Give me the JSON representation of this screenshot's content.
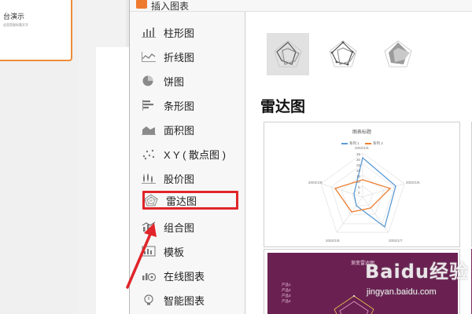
{
  "background_app": {
    "slide_title": "台演示",
    "slide_subtitle": "这里是副标题文字"
  },
  "dialog": {
    "title": "插入图表",
    "sidebar": {
      "items": [
        {
          "label": "柱形图",
          "icon": "column-chart-icon"
        },
        {
          "label": "折线图",
          "icon": "line-chart-icon"
        },
        {
          "label": "饼图",
          "icon": "pie-chart-icon"
        },
        {
          "label": "条形图",
          "icon": "bar-chart-icon"
        },
        {
          "label": "面积图",
          "icon": "area-chart-icon"
        },
        {
          "label": "X Y ( 散点图 )",
          "icon": "scatter-chart-icon"
        },
        {
          "label": "股价图",
          "icon": "stock-chart-icon"
        },
        {
          "label": "雷达图",
          "icon": "radar-chart-icon"
        },
        {
          "label": "组合图",
          "icon": "combo-chart-icon"
        },
        {
          "label": "模板",
          "icon": "template-icon"
        },
        {
          "label": "在线图表",
          "icon": "online-chart-icon"
        },
        {
          "label": "智能图表",
          "icon": "smart-chart-icon"
        }
      ],
      "selected": "雷达图"
    },
    "main": {
      "section_title": "雷达图",
      "subtypes": [
        "radar",
        "radar-with-markers",
        "filled-radar"
      ],
      "preview1": {
        "title": "图表标题",
        "legend": [
          "系列 1",
          "系列 2"
        ],
        "axis_labels": [
          "2002/1/5",
          "2002/1/6",
          "2002/1/7",
          "2002/1/8",
          "2002/1/9"
        ],
        "tick_labels": [
          "35",
          "30",
          "25",
          "20",
          "15",
          "10",
          "5",
          "0"
        ]
      },
      "preview2": {
        "title": "渐变雷达图",
        "legend": [
          "产品1",
          "产品2",
          "产品3",
          "产品4"
        ]
      }
    }
  },
  "colors": {
    "accent_orange": "#ee7a2f",
    "highlight_red": "#e0252a",
    "series1": "#5b9bd5",
    "series2": "#ed7d31",
    "purple_bg": "#6a2152"
  },
  "watermark": {
    "brand": "Baidu经验",
    "url": "jingyan.baidu.com"
  }
}
